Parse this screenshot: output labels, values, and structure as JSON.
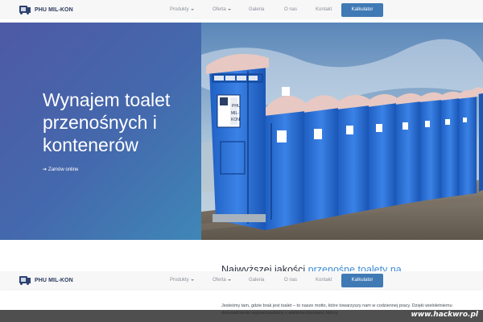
{
  "nav": {
    "brand_name": "PHU MIL-KON",
    "items": [
      {
        "label": "Produkty",
        "dropdown": true
      },
      {
        "label": "Oferta",
        "dropdown": true
      },
      {
        "label": "Galeria",
        "dropdown": false
      },
      {
        "label": "O nas",
        "dropdown": false
      },
      {
        "label": "Kontakt",
        "dropdown": false
      }
    ],
    "cta_label": "Kalkulator"
  },
  "hero": {
    "title": "Wynajem toalet przenośnych i kontenerów",
    "link_label": "Zamów online",
    "image_sign": "PHU MIL-KON"
  },
  "content": {
    "heading_prefix": "Najwyższej jakości ",
    "heading_highlight": "przenośne toalety na",
    "paragraph": "Jesteśmy tam, gdzie brak jest toalet – to nasze motto, które towarzyszy nam w codziennej pracy. Dzięki wieloletniemu doświadczeniu wypracowaliśmy z wieloma klientami, którzy"
  },
  "watermark": "www.hackwro.pl",
  "colors": {
    "accent": "#3f7ab5",
    "hero_gradient_start": "#4e59a5",
    "hero_gradient_end": "#3f87b7",
    "highlight": "#3b8ad6"
  }
}
